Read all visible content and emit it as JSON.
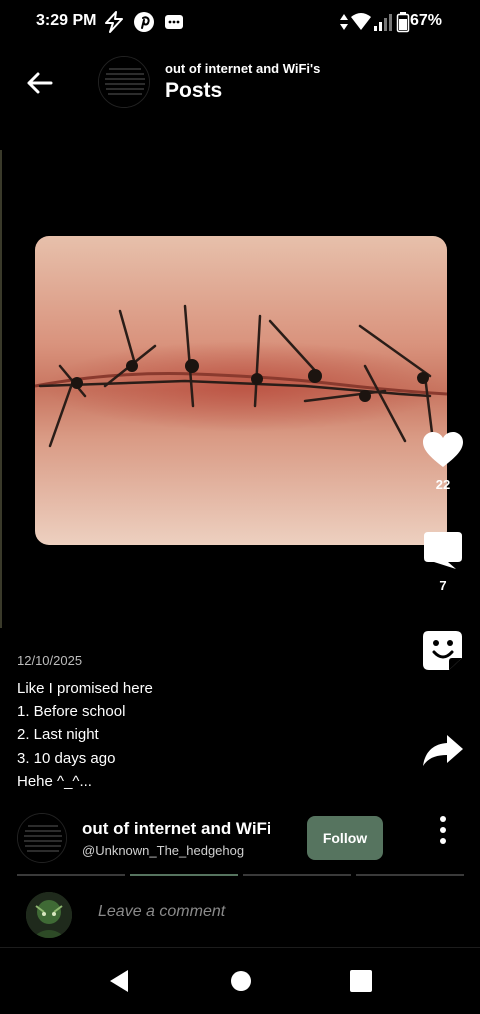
{
  "status_bar": {
    "time": "3:29 PM",
    "battery": "67%",
    "icons": [
      "flash-icon",
      "pinterest-icon",
      "message-icon",
      "data-arrows-icon",
      "wifi-icon",
      "signal-icon",
      "battery-icon"
    ]
  },
  "header": {
    "channel_name": "out of internet and WiFi's",
    "title": "Posts",
    "avatar_text": "PLEASE, GET IT"
  },
  "post": {
    "date": "12/10/2025",
    "lines": [
      "Like I promised here",
      "1. Before school",
      "2. Last night",
      "3. 10 days ago",
      "Hehe ^_^..."
    ]
  },
  "actions": {
    "likes": "22",
    "comments": "7"
  },
  "author": {
    "name": "out of internet and WiFi's",
    "handle": "@Unknown_The_hedgehog",
    "follow_label": "Follow"
  },
  "carousel": {
    "count": 4,
    "active_index": 1
  },
  "comment": {
    "placeholder": "Leave a comment"
  },
  "colors": {
    "background": "#000000",
    "accent": "#56745f",
    "skin": "#e8b8a0"
  }
}
